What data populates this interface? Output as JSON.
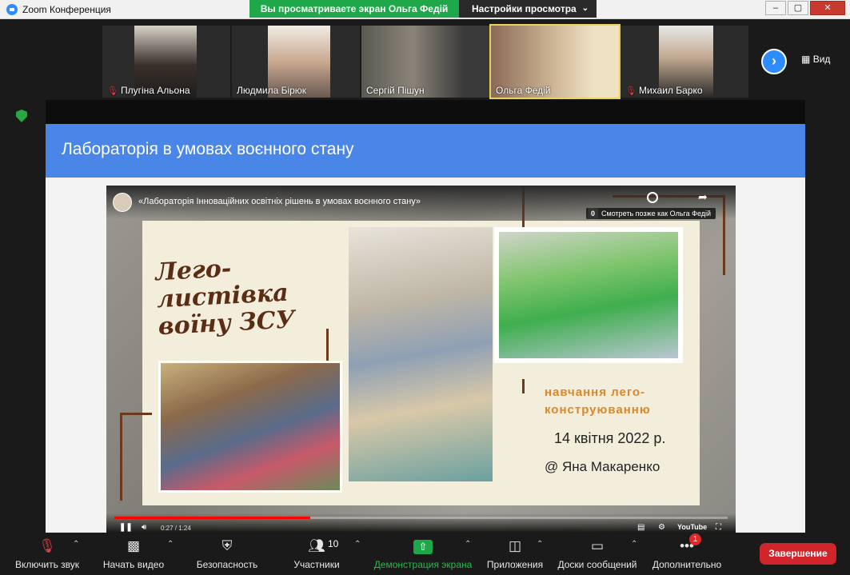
{
  "window": {
    "title": "Zoom Конференция",
    "share_banner": "Вы просматриваете экран Ольга Федій",
    "view_options": "Настройки просмотра",
    "buttons": [
      "–",
      "▢",
      "✕"
    ]
  },
  "participants": [
    {
      "name": "Плугіна Альона",
      "muted": true,
      "active": false
    },
    {
      "name": "Людмила Бірюк",
      "muted": false,
      "active": false
    },
    {
      "name": "Сергій Пішун",
      "muted": false,
      "active": false
    },
    {
      "name": "Ольга Федій",
      "muted": false,
      "active": true
    },
    {
      "name": "Михаил Барко",
      "muted": true,
      "active": false
    }
  ],
  "view_label": "Вид",
  "slide": {
    "heading": "Лабораторія в умовах воєнного стану",
    "video": {
      "title": "«Лабораторія Інноваційних освітніх рішень в умовах воєнного стану»",
      "watch_later": "Смотреть позже как Ольга Федій",
      "watch_count": "0",
      "time": "0:27 / 1:24",
      "progress": 0.32,
      "brand": "YouTube"
    },
    "poster": {
      "lego_title_line1": "Лего-листівка",
      "lego_title_line2": "воїну ЗСУ",
      "subtitle_line1": "навчання лего-",
      "subtitle_line2": "конструюванню",
      "date": "14 квітня 2022 р.",
      "author": "@ Яна Макаренко"
    }
  },
  "toolbar": {
    "unmute": "Включить звук",
    "start_video": "Начать видео",
    "security": "Безопасность",
    "participants": "Участники",
    "participants_count": "10",
    "share": "Демонстрация экрана",
    "apps": "Приложения",
    "whiteboards": "Доски сообщений",
    "more": "Дополнительно",
    "more_badge": "1",
    "end": "Завершение"
  },
  "colors": {
    "accent": "#2d8cff",
    "share_green": "#1fa84a",
    "end_red": "#d1242b",
    "slide_header": "#4a86e8"
  }
}
